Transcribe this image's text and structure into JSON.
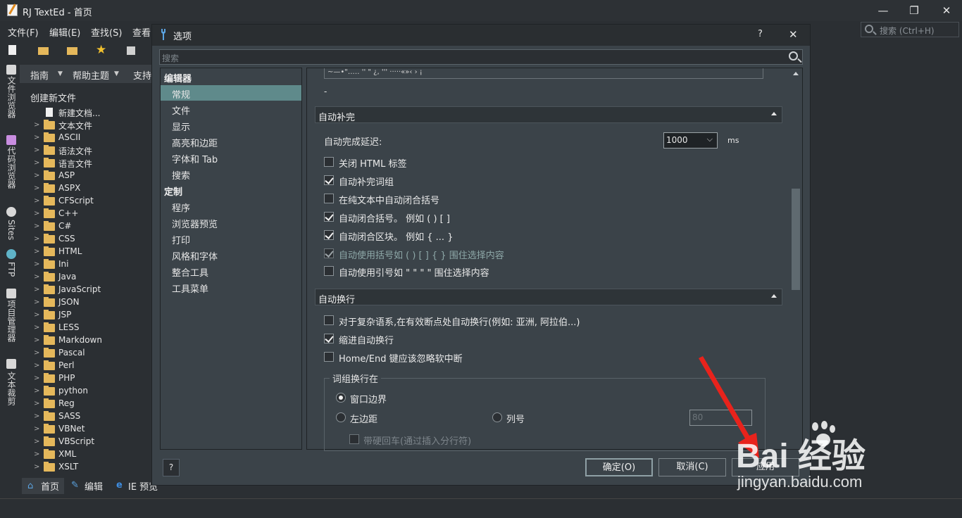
{
  "app": {
    "title": "RJ TextEd - 首页",
    "window_controls": [
      "—",
      "❐",
      "✕"
    ]
  },
  "menu": [
    "文件(F)",
    "编辑(E)",
    "查找(S)",
    "查看"
  ],
  "main_search": {
    "placeholder": "搜索 (Ctrl+H)"
  },
  "left_tabs": [
    "文件浏览器",
    "代码浏览器",
    "Sites",
    "FTP",
    "项目管理器",
    "文本裁剪"
  ],
  "guide_bar": [
    "指南",
    "帮助主题",
    "支持"
  ],
  "file_panel": {
    "title": "创建新文件",
    "new_doc": "新建文档...",
    "items": [
      "文本文件",
      "ASCII",
      "语法文件",
      "语言文件",
      "ASP",
      "ASPX",
      "CFScript",
      "C++",
      "C#",
      "CSS",
      "HTML",
      "Ini",
      "Java",
      "JavaScript",
      "JSON",
      "JSP",
      "LESS",
      "Markdown",
      "Pascal",
      "Perl",
      "PHP",
      "python",
      "Reg",
      "SASS",
      "VBNet",
      "VBScript",
      "XML",
      "XSLT"
    ]
  },
  "bottom_tabs": [
    "首页",
    "编辑",
    "IE 预览"
  ],
  "dialog": {
    "title": "选项",
    "help_symbol": "?",
    "close_symbol": "✕",
    "search_placeholder": "搜索",
    "nav": {
      "editor_cat": "编辑器",
      "editor_items": [
        "常规",
        "文件",
        "显示",
        "高亮和边距",
        "字体和 Tab",
        "搜索"
      ],
      "custom_cat": "定制",
      "custom_items": [
        "程序",
        "浏览器预览",
        "打印",
        "风格和字体",
        "整合工具",
        "工具菜单"
      ]
    },
    "top_text": "~—•\"‥… '' \" ¿, ''' ·····«»‹ › ¡",
    "top_dash": "-",
    "autocomplete": {
      "title": "自动补完",
      "delay_label": "自动完成延迟:",
      "delay_value": "1000",
      "delay_unit": "ms",
      "options": [
        {
          "label": "关闭 HTML 标签",
          "checked": false
        },
        {
          "label": "自动补完词组",
          "checked": true
        },
        {
          "label": "在纯文本中自动闭合括号",
          "checked": false
        },
        {
          "label": "自动闭合括号。 例如 ( ) [ ]",
          "checked": true
        },
        {
          "label": "自动闭合区块。 例如 { ... }",
          "checked": true
        },
        {
          "label": "自动使用括号如 ( ) [ ] { } 围住选择内容",
          "checked": true
        },
        {
          "label": "自动使用引号如 \" \" \" \" 围住选择内容",
          "checked": false
        }
      ]
    },
    "wordwrap": {
      "title": "自动换行",
      "options": [
        {
          "label": "对于复杂语系,在有效断点处自动换行(例如: 亚洲, 阿拉伯...)",
          "checked": false
        },
        {
          "label": "缩进自动换行",
          "checked": true
        },
        {
          "label": "Home/End 键应该忽略软中断",
          "checked": false
        }
      ],
      "group_title": "词组换行在",
      "radio_window": "窗口边界",
      "radio_left": "左边距",
      "radio_col": "列号",
      "col_value": "80",
      "hard_return": "带硬回车(通过插入分行符)"
    },
    "buttons": {
      "ok": "确定(O)",
      "cancel": "取消(C)",
      "apply": "应用"
    }
  },
  "watermark": {
    "brand": "Bai  经验",
    "url": "jingyan.baidu.com"
  },
  "colors": {
    "selection": "#5f8a8b",
    "accent_arrow": "#e8231c",
    "folder": "#e5b85b"
  }
}
